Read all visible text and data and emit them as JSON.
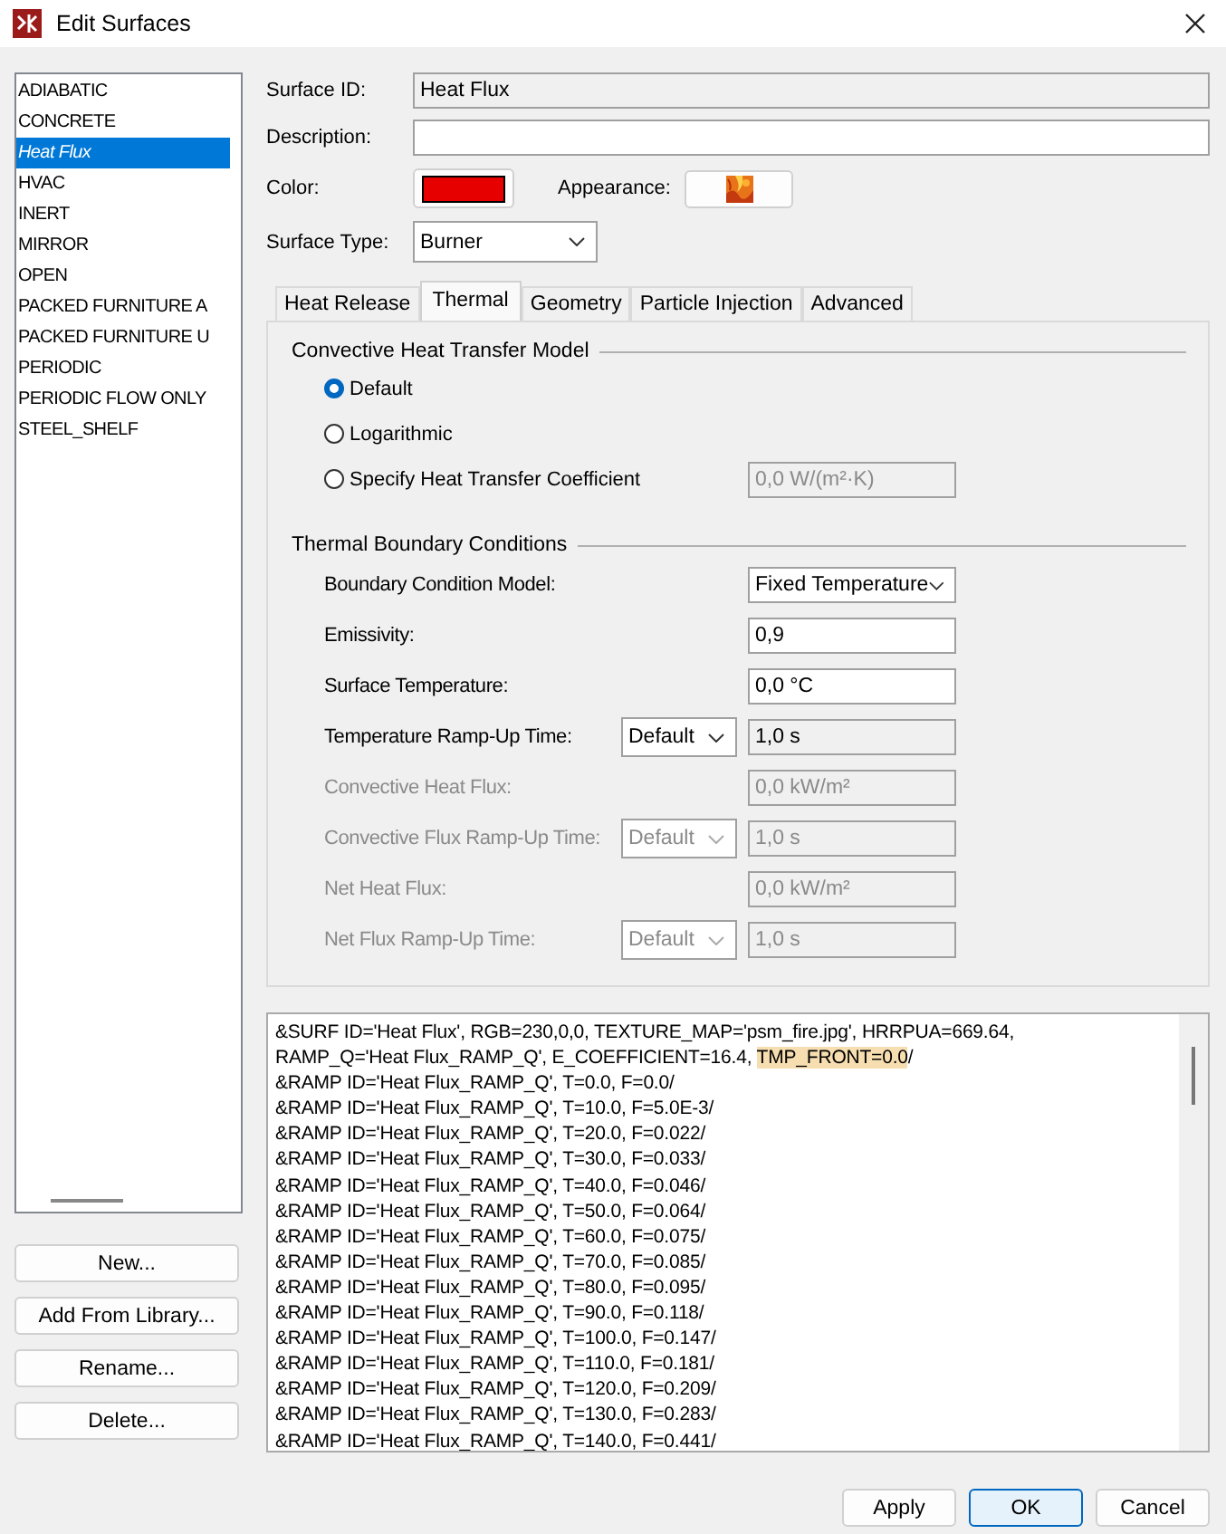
{
  "window": {
    "title": "Edit Surfaces"
  },
  "surfaces": [
    {
      "label": "ADIABATIC",
      "selected": false
    },
    {
      "label": "CONCRETE",
      "selected": false
    },
    {
      "label": "Heat Flux",
      "selected": true
    },
    {
      "label": "HVAC",
      "selected": false
    },
    {
      "label": "INERT",
      "selected": false
    },
    {
      "label": "MIRROR",
      "selected": false
    },
    {
      "label": "OPEN",
      "selected": false
    },
    {
      "label": "PACKED FURNITURE A",
      "selected": false
    },
    {
      "label": "PACKED FURNITURE U",
      "selected": false
    },
    {
      "label": "PERIODIC",
      "selected": false
    },
    {
      "label": "PERIODIC FLOW ONLY",
      "selected": false
    },
    {
      "label": "STEEL_SHELF",
      "selected": false
    }
  ],
  "list_buttons": [
    "New...",
    "Add From Library...",
    "Rename...",
    "Delete..."
  ],
  "form": {
    "surface_id": {
      "label": "Surface ID:",
      "value": "Heat Flux",
      "disabled": true
    },
    "description": {
      "label": "Description:"
    },
    "color": {
      "label": "Color:",
      "color": "#e60000"
    },
    "appearance": {
      "label": "Appearance:"
    },
    "surface_type": {
      "label": "Surface Type:",
      "value": "Burner"
    }
  },
  "tabs": [
    {
      "label": "Heat Release",
      "selected": false
    },
    {
      "label": "Thermal",
      "selected": true
    },
    {
      "label": "Geometry",
      "selected": false
    },
    {
      "label": "Particle Injection",
      "selected": false
    },
    {
      "label": "Advanced",
      "selected": false
    }
  ],
  "convective": {
    "title": "Convective Heat Transfer Model",
    "options": [
      {
        "label": "Default",
        "selected": true
      },
      {
        "label": "Logarithmic",
        "selected": false
      },
      {
        "label": "Specify Heat Transfer Coefficient",
        "selected": false,
        "value": "0,0 W/(m²·K)",
        "disabled": true
      }
    ]
  },
  "boundary": {
    "title": "Thermal Boundary Conditions",
    "rows": [
      {
        "kind": "dropdown",
        "label": "Boundary Condition Model:",
        "value": "Fixed Temperature",
        "disabled": false
      },
      {
        "kind": "field",
        "label": "Emissivity:",
        "value": "0,9",
        "disabled": false
      },
      {
        "kind": "field",
        "label": "Surface Temperature:",
        "value": "0,0 °C",
        "disabled": false
      },
      {
        "kind": "ramp",
        "label": "Temperature Ramp-Up Time:",
        "ramp": "Default",
        "value": "1,0 s",
        "disabled": false
      },
      {
        "kind": "field",
        "label": "Convective Heat Flux:",
        "value": "0,0 kW/m²",
        "disabled": true
      },
      {
        "kind": "ramp",
        "label": "Convective Flux Ramp-Up Time:",
        "ramp": "Default",
        "value": "1,0 s",
        "disabled": true
      },
      {
        "kind": "field",
        "label": "Net Heat Flux:",
        "value": "0,0 kW/m²",
        "disabled": true
      },
      {
        "kind": "ramp",
        "label": "Net Flux Ramp-Up Time:",
        "ramp": "Default",
        "value": "1,0 s",
        "disabled": true
      }
    ]
  },
  "code_lines": [
    [
      {
        "text": "&SURF ID='Heat Flux', RGB=230,0,0, TEXTURE_MAP='psm_fire.jpg', HRRPUA=669.64,",
        "highlighted": false
      }
    ],
    [
      {
        "text": "RAMP_Q='Heat Flux_RAMP_Q', E_COEFFICIENT=16.4, ",
        "highlighted": false
      },
      {
        "text": "TMP_FRONT=0.0",
        "highlighted": true
      },
      {
        "text": "/",
        "highlighted": false
      }
    ],
    [
      {
        "text": "&RAMP ID='Heat Flux_RAMP_Q', T=0.0, F=0.0/",
        "highlighted": false
      }
    ],
    [
      {
        "text": "&RAMP ID='Heat Flux_RAMP_Q', T=10.0, F=5.0E-3/",
        "highlighted": false
      }
    ],
    [
      {
        "text": "&RAMP ID='Heat Flux_RAMP_Q', T=20.0, F=0.022/",
        "highlighted": false
      }
    ],
    [
      {
        "text": "&RAMP ID='Heat Flux_RAMP_Q', T=30.0, F=0.033/",
        "highlighted": false
      }
    ],
    [
      {
        "text": "&RAMP ID='Heat Flux_RAMP_Q', T=40.0, F=0.046/",
        "highlighted": false
      }
    ],
    [
      {
        "text": "&RAMP ID='Heat Flux_RAMP_Q', T=50.0, F=0.064/",
        "highlighted": false
      }
    ],
    [
      {
        "text": "&RAMP ID='Heat Flux_RAMP_Q', T=60.0, F=0.075/",
        "highlighted": false
      }
    ],
    [
      {
        "text": "&RAMP ID='Heat Flux_RAMP_Q', T=70.0, F=0.085/",
        "highlighted": false
      }
    ],
    [
      {
        "text": "&RAMP ID='Heat Flux_RAMP_Q', T=80.0, F=0.095/",
        "highlighted": false
      }
    ],
    [
      {
        "text": "&RAMP ID='Heat Flux_RAMP_Q', T=90.0, F=0.118/",
        "highlighted": false
      }
    ],
    [
      {
        "text": "&RAMP ID='Heat Flux_RAMP_Q', T=100.0, F=0.147/",
        "highlighted": false
      }
    ],
    [
      {
        "text": "&RAMP ID='Heat Flux_RAMP_Q', T=110.0, F=0.181/",
        "highlighted": false
      }
    ],
    [
      {
        "text": "&RAMP ID='Heat Flux_RAMP_Q', T=120.0, F=0.209/",
        "highlighted": false
      }
    ],
    [
      {
        "text": "&RAMP ID='Heat Flux_RAMP_Q', T=130.0, F=0.283/",
        "highlighted": false
      }
    ],
    [
      {
        "text": "&RAMP ID='Heat Flux_RAMP_Q', T=140.0, F=0.441/",
        "highlighted": false
      }
    ]
  ],
  "footer_buttons": [
    {
      "label": "Apply",
      "default": false
    },
    {
      "label": "OK",
      "default": true
    },
    {
      "label": "Cancel",
      "default": false
    }
  ]
}
